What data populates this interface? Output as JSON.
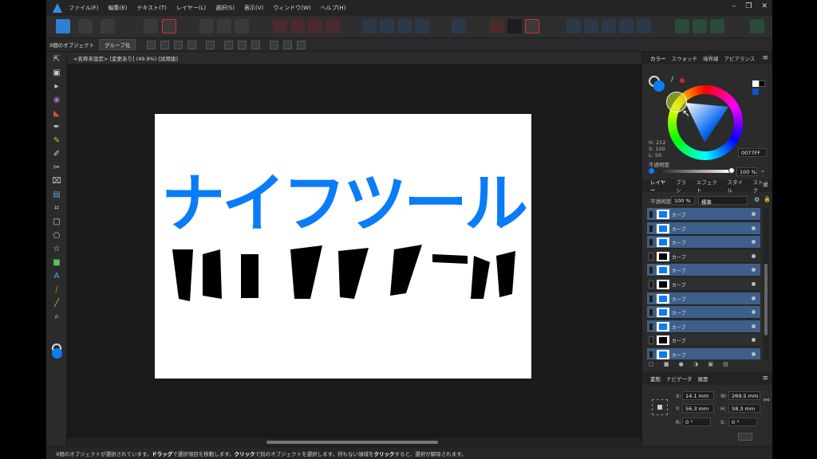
{
  "menu": {
    "items": [
      "ファイル(F)",
      "編集(E)",
      "テキスト(T)",
      "レイヤー(L)",
      "選択(S)",
      "表示(V)",
      "ウィンドウ(W)",
      "ヘルプ(H)"
    ]
  },
  "context_bar": {
    "selection_count": "9個のオブジェクト",
    "group_button": "グループ化"
  },
  "document": {
    "tab_title": "<名称未設定> [変更あり] (49.9%) [試用版]",
    "artwork_text": "ナイフツール"
  },
  "colors": {
    "accent": "#0077FF",
    "artwork_blue": "#0a7cf7",
    "artwork_black": "#000000"
  },
  "color_panel": {
    "tabs": [
      "カラー",
      "スウォッチ",
      "境界線",
      "アピアランス"
    ],
    "h": "H: 212",
    "s": "S: 100",
    "l": "L: 50",
    "hex": "0077FF",
    "opacity_label": "不透明度",
    "opacity_value": "100 %"
  },
  "layers_panel": {
    "tabs": [
      "レイヤー",
      "ブラシ",
      "エフェクト",
      "スタイル",
      "ストック"
    ],
    "opacity_label": "不透明度",
    "opacity_value": "100 %",
    "blend_mode": "標準",
    "rows": [
      {
        "name": "カーブ",
        "selected": true,
        "thumb": "blue"
      },
      {
        "name": "カーブ",
        "selected": true,
        "thumb": "blue"
      },
      {
        "name": "カーブ",
        "selected": true,
        "thumb": "blue"
      },
      {
        "name": "カーブ",
        "selected": false,
        "thumb": "black"
      },
      {
        "name": "カーブ",
        "selected": true,
        "thumb": "blue"
      },
      {
        "name": "カーブ",
        "selected": false,
        "thumb": "black"
      },
      {
        "name": "カーブ",
        "selected": true,
        "thumb": "blue"
      },
      {
        "name": "カーブ",
        "selected": true,
        "thumb": "blue"
      },
      {
        "name": "カーブ",
        "selected": true,
        "thumb": "blue"
      },
      {
        "name": "カーブ",
        "selected": false,
        "thumb": "black"
      },
      {
        "name": "カーブ",
        "selected": true,
        "thumb": "blue"
      },
      {
        "name": "カーブ",
        "selected": false,
        "thumb": "black"
      }
    ]
  },
  "transform_panel": {
    "tabs": [
      "変形",
      "ナビゲータ",
      "履歴"
    ],
    "x_label": "X:",
    "x_value": "14.1 mm",
    "y_label": "Y:",
    "y_value": "56.3 mm",
    "w_label": "W:",
    "w_value": "269.5 mm",
    "h_label": "H:",
    "h_value": "58.3 mm",
    "r_label": "R:",
    "r_value": "0 °",
    "s_label": "S:",
    "s_value": "0 °"
  },
  "status": {
    "part1": "9個のオブジェクトが選択されています。",
    "bold1": "ドラッグ",
    "part2": "で選択項目を移動します。",
    "bold2": "クリック",
    "part3": "で別のオブジェクトを選択します。何もない領域を",
    "bold3": "クリック",
    "part4": "すると、選択が解除されます。"
  }
}
